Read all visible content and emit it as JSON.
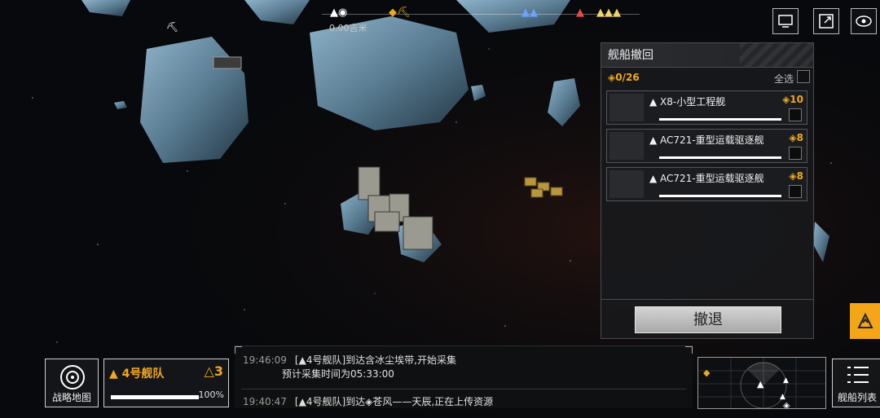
{
  "top_nav": {
    "distance_label": "0.00吉米",
    "markers": [
      "base-marker",
      "location-pin-icon",
      "mining-marker",
      "ally-fleet-marker",
      "enemy-fleet-marker"
    ]
  },
  "top_buttons": {
    "icons": [
      "screen-share-icon",
      "external-link-icon",
      "eye-icon"
    ]
  },
  "recall_panel": {
    "title": "舰船撤回",
    "count": "0/26",
    "select_all": "全选",
    "ships": [
      {
        "name": "X8-小型工程舰",
        "cost": "10"
      },
      {
        "name": "AC721-重型运载驱逐舰",
        "cost": "8"
      },
      {
        "name": "AC721-重型运载驱逐舰",
        "cost": "8"
      }
    ],
    "retreat_label": "撤退"
  },
  "strategy_map": {
    "label": "战略地图"
  },
  "fleet": {
    "name": "4号舰队",
    "number": "3",
    "hp_percent": "100%",
    "hp_fill": 1.0
  },
  "log": {
    "entries": [
      {
        "time": "19:46:09",
        "text": "[▲4号舰队]到达含冰尘埃带,开始采集",
        "sub": "预计采集时间为05:33:00"
      },
      {
        "time": "19:40:47",
        "text": "[▲4号舰队]到达◈苍风——天辰,正在上传资源"
      }
    ]
  },
  "ship_list": {
    "label": "舰船列表"
  },
  "colors": {
    "accent": "#f0a81e",
    "panel_bg": "#18191c",
    "text": "#e8e8e8"
  }
}
